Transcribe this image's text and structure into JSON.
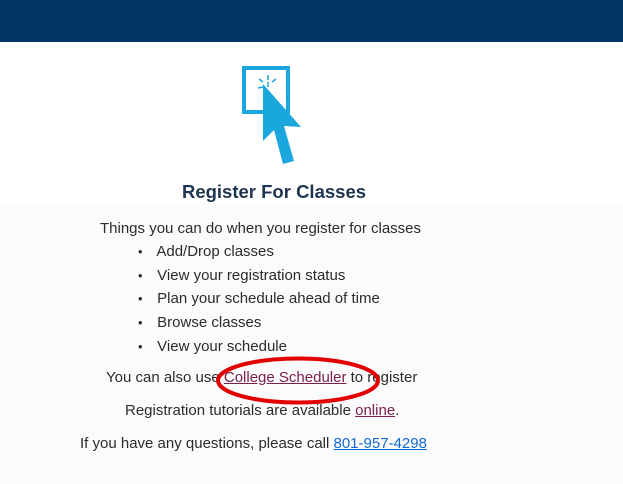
{
  "colors": {
    "header_bg": "#003463",
    "title": "#1f3550",
    "icon": "#1aa7dd",
    "link_primary": "#7b2050",
    "phone_link": "#1169d6",
    "annotation": "#e20000"
  },
  "hero": {
    "icon_name": "pointer-click-icon",
    "title": "Register For Classes"
  },
  "intro": {
    "text": "Things you can do when you register for classes"
  },
  "actions": [
    {
      "bullet": "•",
      "label": "Add/Drop classes"
    },
    {
      "bullet": "•",
      "label": "View your registration status"
    },
    {
      "bullet": "•",
      "label": "Plan your schedule ahead of time"
    },
    {
      "bullet": "•",
      "label": "Browse classes"
    },
    {
      "bullet": "•",
      "label": "View your schedule"
    }
  ],
  "scheduler": {
    "prefix": "You can also use ",
    "link": "College Scheduler",
    "suffix": " to register"
  },
  "tutorials": {
    "prefix": "Registration tutorials are available ",
    "link": "online",
    "suffix": "."
  },
  "questions": {
    "prefix": "If you have any questions, please call ",
    "phone": "801-957-4298"
  }
}
